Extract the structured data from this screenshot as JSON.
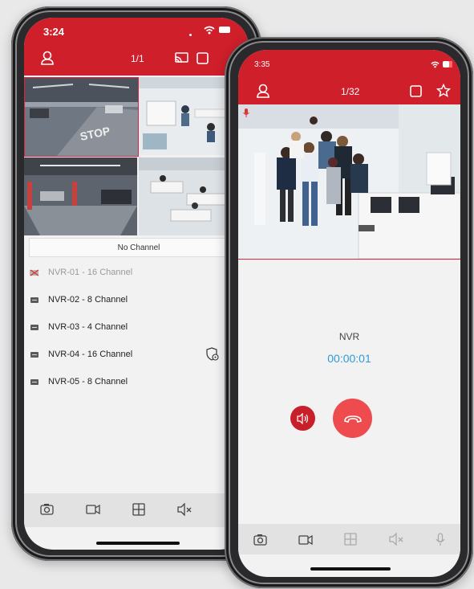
{
  "left": {
    "status_time": "3:24",
    "page_counter": "1/1",
    "no_channel_label": "No Channel",
    "devices": [
      {
        "label": "NVR-01 - 16 Channel",
        "offline": true
      },
      {
        "label": "NVR-02 - 8 Channel"
      },
      {
        "label": "NVR-03 - 4 Channel"
      },
      {
        "label": "NVR-04 - 16 Channel"
      },
      {
        "label": "NVR-05 - 8 Channel"
      }
    ]
  },
  "right": {
    "status_time": "3:35",
    "page_counter": "1/32",
    "call_name": "NVR",
    "call_timer": "00:00:01"
  },
  "colors": {
    "brand_red": "#cf1f2b",
    "timer_blue": "#2e9bd6",
    "hangup": "#ee4b4f"
  }
}
